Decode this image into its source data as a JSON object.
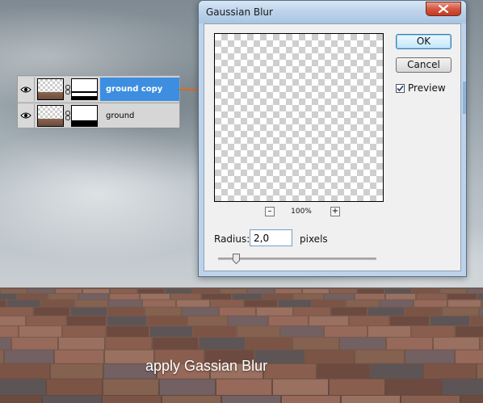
{
  "caption": "apply Gassian Blur",
  "layers_panel": {
    "layers": [
      {
        "name": "ground copy",
        "selected": true
      },
      {
        "name": "ground",
        "selected": false
      }
    ]
  },
  "dialog": {
    "title": "Gaussian Blur",
    "ok_label": "OK",
    "cancel_label": "Cancel",
    "preview_label": "Preview",
    "preview_checked": true,
    "zoom_minus": "–",
    "zoom_plus": "+",
    "zoom_level": "100%",
    "radius_label": "Radius:",
    "radius_value": "2,0",
    "radius_unit": "pixels",
    "radius_slider_fraction": 0.11
  },
  "colors": {
    "selection": "#3d8ee0",
    "arrow": "#e0661a",
    "close_button": "#c9432b"
  }
}
